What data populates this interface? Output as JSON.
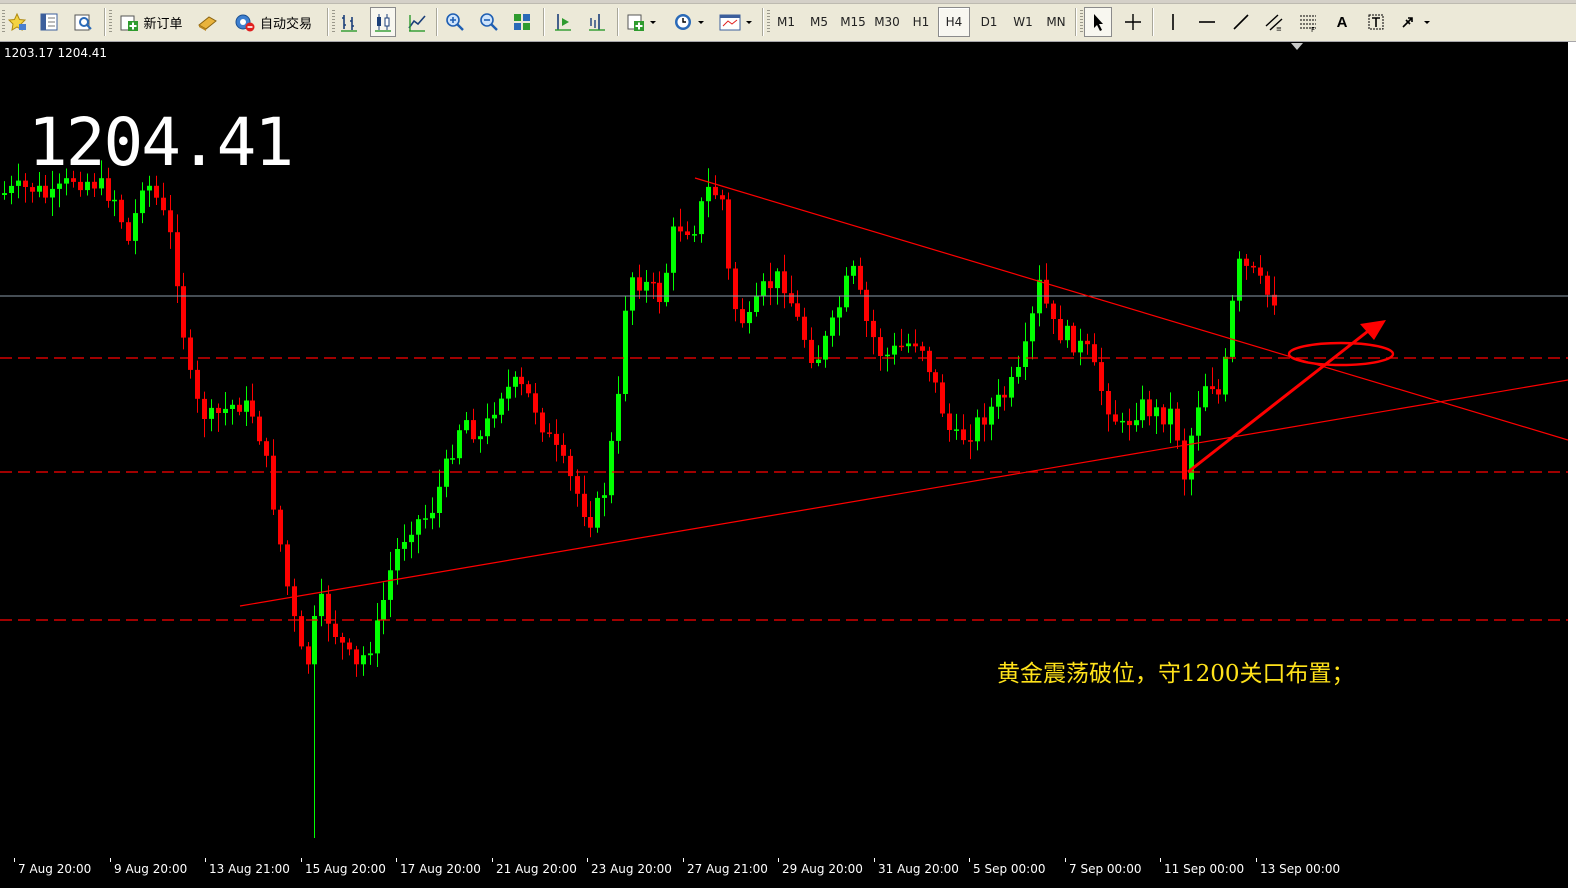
{
  "toolbar": {
    "new_order_label": "新订单",
    "auto_trade_label": "自动交易",
    "timeframes": [
      "M1",
      "M5",
      "M15",
      "M30",
      "H1",
      "H4",
      "D1",
      "W1",
      "MN"
    ],
    "active_timeframe": "H4",
    "text_tool_label": "A",
    "icons": [
      "profiles-icon",
      "market-watch-icon",
      "navigator-icon",
      "new-order-icon",
      "gold-icon",
      "auto-trading-icon",
      "bar-chart-icon",
      "candlestick-icon",
      "line-chart-icon",
      "zoom-in-icon",
      "zoom-out-icon",
      "tile-windows-icon",
      "auto-scroll-icon",
      "chart-shift-icon",
      "indicators-icon",
      "periods-clock-icon",
      "templates-icon",
      "cursor-icon",
      "crosshair-icon",
      "vertical-line-icon",
      "horizontal-line-icon",
      "trend-line-icon",
      "equidistant-channel-icon",
      "fibonacci-icon",
      "text-icon",
      "text-label-icon",
      "arrows-icon"
    ]
  },
  "chart": {
    "header": "1203.17 1204.41",
    "big_price": "1204.41",
    "annotation": "黄金震荡破位，守1200关口布置；",
    "x_axis_labels": [
      "7 Aug 20:00",
      "9 Aug 20:00",
      "13 Aug 21:00",
      "15 Aug 20:00",
      "17 Aug 20:00",
      "21 Aug 20:00",
      "23 Aug 20:00",
      "27 Aug 21:00",
      "29 Aug 20:00",
      "31 Aug 20:00",
      "5 Sep 00:00",
      "7 Sep 00:00",
      "11 Sep 00:00",
      "13 Sep 00:00"
    ],
    "colors": {
      "background": "#000000",
      "bull_candle": "#00ff00",
      "bear_candle": "#ff0000",
      "support_resistance": "#ff0000",
      "bid_line": "#8a9aa8",
      "annotation_text": "#ffe21a"
    }
  }
}
